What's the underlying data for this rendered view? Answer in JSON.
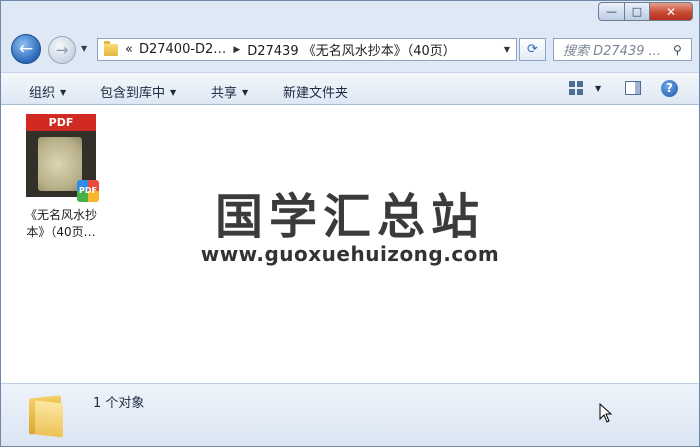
{
  "window": {
    "controls": {
      "minimize": "—",
      "maximize": "□",
      "close": "✕"
    }
  },
  "nav": {
    "back_glyph": "←",
    "forward_glyph": "→",
    "history_dropdown": "▼"
  },
  "address": {
    "overflow": "«",
    "crumbs": [
      "D27400-D2…",
      "D27439 《无名风水抄本》（40页）"
    ],
    "separator": "▶",
    "dropdown": "▼",
    "refresh_glyph": "⟳"
  },
  "search": {
    "placeholder": "搜索 D27439 ...",
    "icon": "search-icon"
  },
  "toolbar": {
    "organize": "组织",
    "include_library": "包含到库中",
    "share": "共享",
    "new_folder": "新建文件夹",
    "view_dropdown": "▼",
    "help": "?"
  },
  "file": {
    "thumb_label": "PDF",
    "badge_label": "PDF",
    "name_line1": "《无名风水抄",
    "name_line2": "本》（40页…"
  },
  "watermark": {
    "title": "国学汇总站",
    "url": "www.guoxuehuizong.com"
  },
  "status": {
    "count": "1 个对象"
  }
}
